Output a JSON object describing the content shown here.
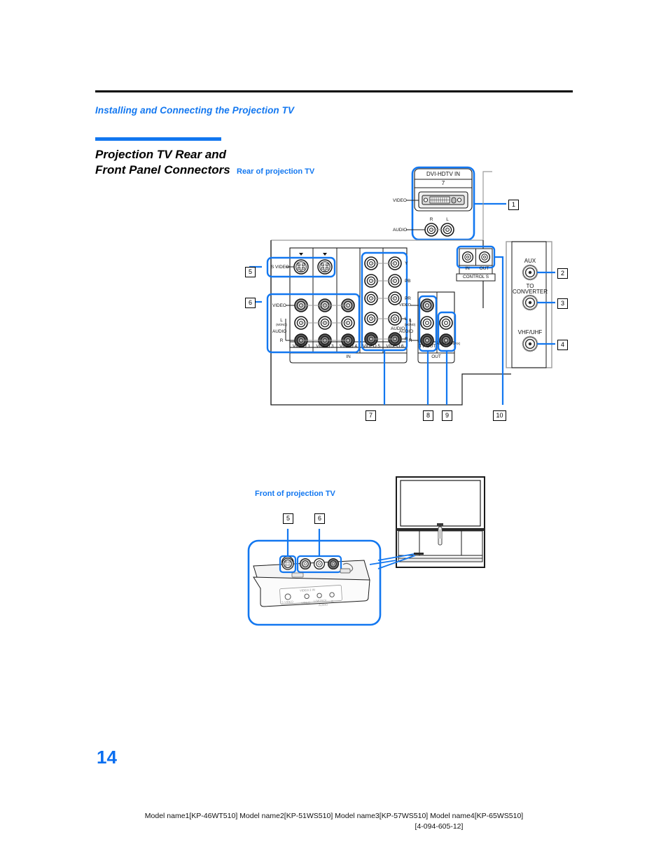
{
  "document": {
    "section_kicker": "Installing and Connecting the Projection TV",
    "page_title": "Projection TV Rear and Front Panel Connectors",
    "page_number": "14",
    "footer_line1": "Model name1[KP-46WT510] Model name2[KP-51WS510] Model name3[KP-57WS510] Model name4[KP-65WS510]",
    "footer_line2": "[4-094-605-12]",
    "accent_color": "#1277f0",
    "rule_color": "#000000"
  },
  "figures": {
    "rear_caption": "Rear of projection TV",
    "front_caption": "Front of projection TV"
  },
  "rear_panel": {
    "dvi_block": {
      "title": "DVI-HDTV IN",
      "number": "7",
      "video_label": "VIDEO",
      "audio_label": "AUDIO",
      "jack_r": "R",
      "jack_l": "L"
    },
    "input_block": {
      "svideo_label": "S VIDEO",
      "video_label": "VIDEO",
      "audio_label": "AUDIO",
      "left_label": "L",
      "mono_label": "(MONO)",
      "right_label": "R",
      "group_label": "IN",
      "columns": [
        "VIDEO 1",
        "VIDEO 3",
        "VIDEO 4",
        "VIDEO 5",
        "VIDEO 6"
      ],
      "component_labels": [
        "Y",
        "PB",
        "PR",
        "L",
        "R"
      ],
      "component_audio_label": "AUDIO"
    },
    "output_block": {
      "video_label": "VIDEO",
      "audio_label": "AUDIO",
      "left_label": "L",
      "mono_label": "(MONO)",
      "right_label": "R",
      "group_label": "OUT",
      "columns": [
        "TV OUT",
        "AUDIO (VAR/FIX)"
      ]
    },
    "control_s": {
      "title": "CONTROL S",
      "in_label": "IN",
      "out_label": "OUT"
    },
    "antenna_block": {
      "aux_label": "AUX",
      "converter_label_line1": "TO",
      "converter_label_line2": "CONVERTER",
      "vhf_label": "VHF/UHF"
    },
    "callouts": [
      "1",
      "2",
      "3",
      "4",
      "5",
      "6",
      "7",
      "8",
      "9",
      "10"
    ]
  },
  "front_panel": {
    "callouts": [
      "5",
      "6"
    ],
    "panel_title": "VIDEO 2 IN",
    "jack_labels": [
      "S VIDEO",
      "VIDEO",
      "L(MONO)",
      "R"
    ],
    "audio_label": "AUDIO"
  }
}
